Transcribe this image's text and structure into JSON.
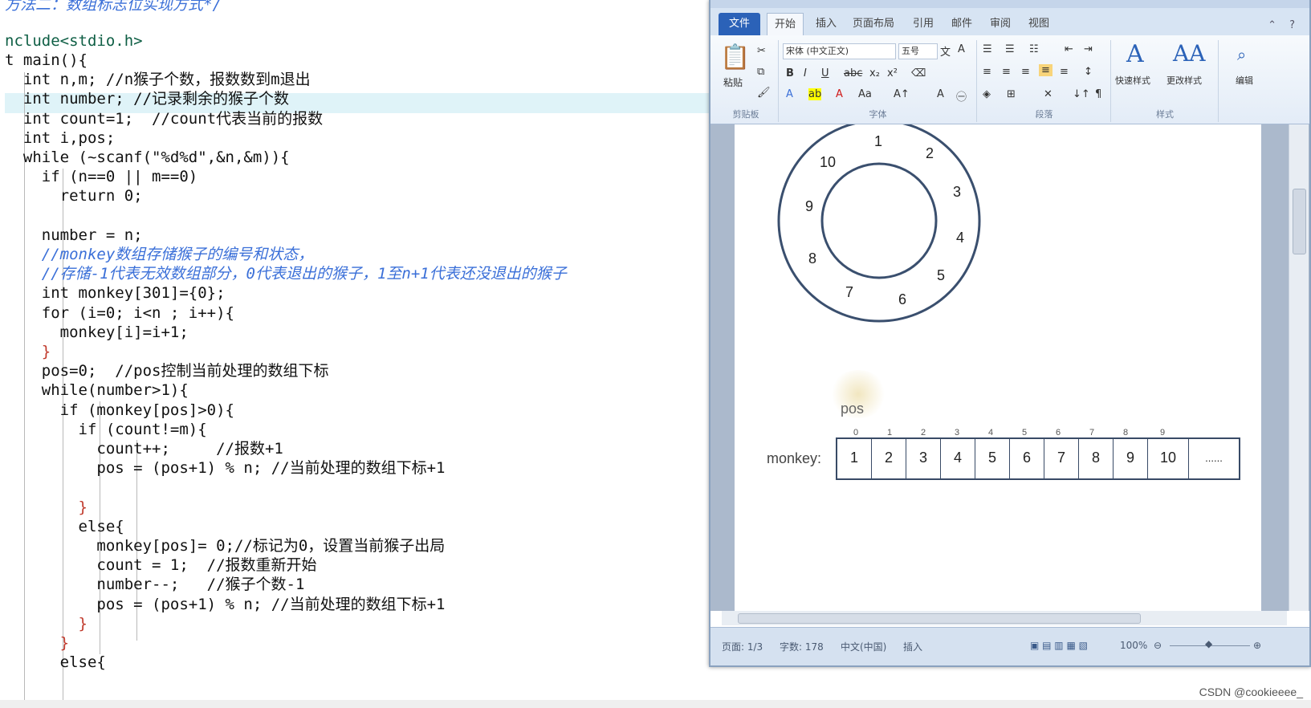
{
  "code": {
    "lines": [
      "方法二：数组标志位实现方式*/",
      "nclude<stdio.h>",
      "t main(){",
      "  int n,m; //n猴子个数，报数数到m退出",
      "  int number; //记录剩余的猴子个数",
      "  int count=1;  //count代表当前的报数",
      "  int i,pos;",
      "  while (~scanf(\"%d%d\",&n,&m)){",
      "    if (n==0 || m==0)",
      "      return 0;",
      "",
      "    number = n;",
      "    //monkey数组存储猴子的编号和状态，",
      "    //存储-1代表无效数组部分，0代表退出的猴子，1至n+1代表还没退出的猴子",
      "    int monkey[301]={0};",
      "    for (i=0; i<n ; i++){",
      "      monkey[i]=i+1;",
      "    }",
      "    pos=0;  //pos控制当前处理的数组下标",
      "    while(number>1){",
      "      if (monkey[pos]>0){",
      "        if (count!=m){",
      "          count++;     //报数+1",
      "          pos = (pos+1) % n; //当前处理的数组下标+1",
      "",
      "        }",
      "        else{",
      "          monkey[pos]= 0;//标记为0，设置当前猴子出局",
      "          count = 1;  //报数重新开始",
      "          number--;   //猴子个数-1",
      "          pos = (pos+1) % n; //当前处理的数组下标+1",
      "        }",
      "      }",
      "      else{"
    ]
  },
  "word": {
    "tabs": [
      "文件",
      "开始",
      "插入",
      "页面布局",
      "引用",
      "邮件",
      "审阅",
      "视图"
    ],
    "ribbon": {
      "paste": "粘贴",
      "font_name": "宋体 (中文正文)",
      "font_size": "五号",
      "groups": [
        "剪贴板",
        "字体",
        "段落",
        "样式"
      ],
      "quick_style": "快速样式",
      "change_style": "更改样式",
      "editing": "编辑"
    },
    "dial_numbers": [
      "1",
      "2",
      "3",
      "4",
      "5",
      "6",
      "7",
      "8",
      "9",
      "10"
    ],
    "pos_label": "pos",
    "array_label": "monkey:",
    "array_indices": [
      "0",
      "1",
      "2",
      "3",
      "4",
      "5",
      "6",
      "7",
      "8",
      "9"
    ],
    "array_cells": [
      "1",
      "2",
      "3",
      "4",
      "5",
      "6",
      "7",
      "8",
      "9",
      "10",
      "......"
    ],
    "status": {
      "page": "页面: 1/3",
      "words": "字数: 178",
      "lang": "中文(中国)",
      "mode": "插入",
      "zoom": "100%"
    }
  },
  "watermark": "CSDN @cookieeee_"
}
